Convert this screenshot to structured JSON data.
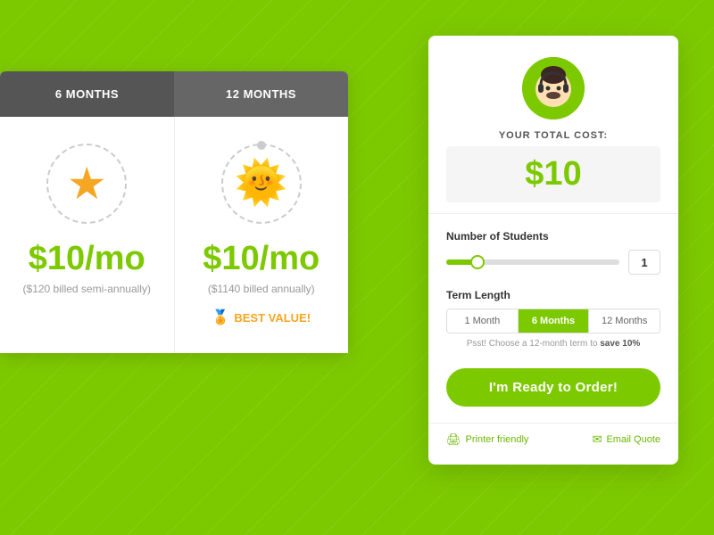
{
  "background_color": "#7dc900",
  "pricing_table": {
    "columns": [
      {
        "id": "6mo",
        "header": "6 MONTHS",
        "bg_color": "#555555",
        "price": "$10/mo",
        "price_sub": "($120 billed semi-annually)",
        "has_star": true
      },
      {
        "id": "12mo",
        "header": "12 MONTHS",
        "bg_color": "#666666",
        "price": "$10/mo",
        "price_sub": "($1140 billed annually)",
        "best_value": "BEST VALUE!",
        "has_sun": true
      }
    ]
  },
  "order_panel": {
    "avatar_label": "support-agent",
    "total_label": "YOUR TOTAL COST:",
    "total_price": "$10",
    "students_section": {
      "label": "Number of Students",
      "value": "1",
      "slider_percent": 18
    },
    "term_section": {
      "label": "Term Length",
      "options": [
        {
          "id": "1mo",
          "label": "1 Month",
          "active": false
        },
        {
          "id": "6mo",
          "label": "6 Months",
          "active": true
        },
        {
          "id": "12mo",
          "label": "12 Months",
          "active": false
        }
      ],
      "promo": "Psst! Choose a 12-month term to",
      "promo_bold": "save 10%"
    },
    "order_button": "I'm Ready to Order!",
    "footer": {
      "printer_label": "Printer friendly",
      "email_label": "Email Quote"
    }
  }
}
